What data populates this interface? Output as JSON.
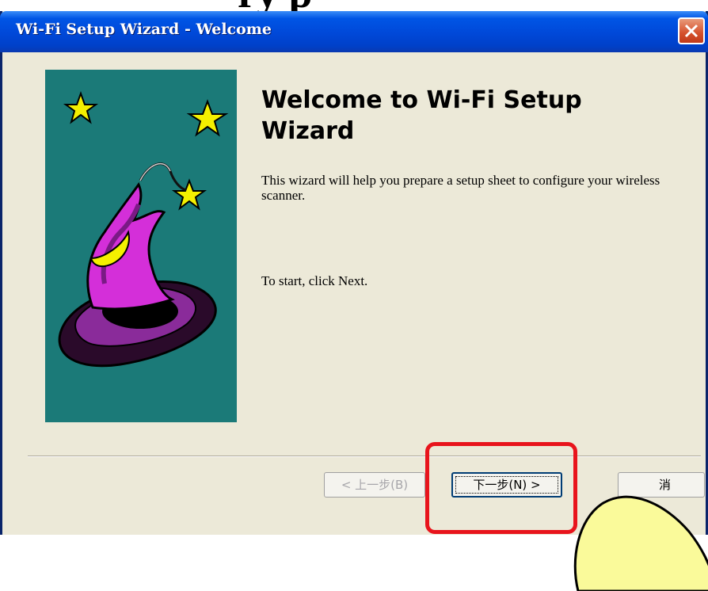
{
  "window": {
    "title": "Wi-Fi Setup Wizard - Welcome"
  },
  "content": {
    "heading": "Welcome to Wi-Fi Setup Wizard",
    "description": "This wizard will help you prepare a setup sheet to configure your wireless scanner.",
    "instruction": "To start, click Next."
  },
  "buttons": {
    "back_label": "< 上一步(B)",
    "next_label": "下一步(N) >",
    "cancel_label": "消"
  },
  "icons": {
    "close": "close-icon",
    "wizard": "wizard-hat-icon",
    "star": "star-icon"
  },
  "colors": {
    "titlebar": "#0048d8",
    "side_panel": "#1b7a78",
    "hat_purple": "#c020c8",
    "star_yellow": "#f4f000",
    "highlight_red": "#e8141c",
    "callout_yellow": "#fafa9a"
  }
}
